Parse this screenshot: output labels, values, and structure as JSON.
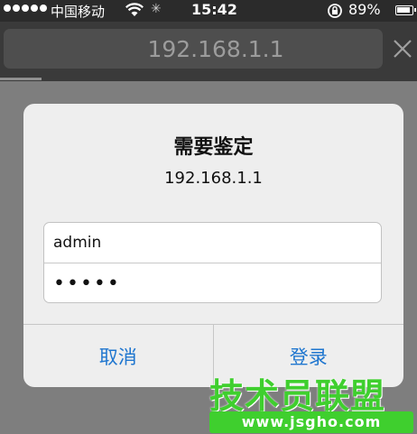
{
  "status_bar": {
    "carrier": "中国移动",
    "time": "15:42",
    "battery": "89%",
    "icons": [
      "signal-dots",
      "wifi-icon",
      "activity-spinner-icon",
      "rotation-lock-icon",
      "battery-icon"
    ]
  },
  "browser": {
    "url": "192.168.1.1",
    "close_icon": "close-icon",
    "progress": 0.1
  },
  "dialog": {
    "title": "需要鉴定",
    "subtitle": "192.168.1.1",
    "username": "admin",
    "password_mask": "•••••",
    "cancel_label": "取消",
    "login_label": "登录"
  },
  "watermark": {
    "title": "技术员联盟",
    "url": "www.jsgho.com"
  },
  "colors": {
    "accent": "#1f76cf",
    "watermark": "#3fcf2e"
  }
}
